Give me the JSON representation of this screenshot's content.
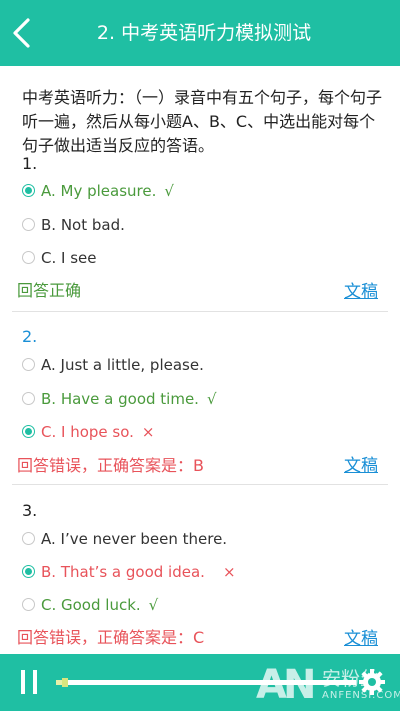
{
  "header": {
    "title": "2. 中考英语听力模拟测试"
  },
  "intro": "中考英语听力：（一）录音中有五个句子，每个句子听一遍，然后从每小题A、B、C、中选出能对每个句子做出适当反应的答语。",
  "questions": [
    {
      "number": "1.",
      "options": [
        {
          "text": "A. My pleasure.",
          "mark": "√",
          "state": "correct-selected"
        },
        {
          "text": "B. Not bad.",
          "mark": "",
          "state": "normal"
        },
        {
          "text": "C. I see",
          "mark": "",
          "state": "normal"
        }
      ],
      "result": "回答正确",
      "doc_link": "文稿"
    },
    {
      "number": "2.",
      "options": [
        {
          "text": "A. Just a little, please.",
          "mark": "",
          "state": "normal"
        },
        {
          "text": "B. Have a good time.",
          "mark": "√",
          "state": "correct"
        },
        {
          "text": "C. I hope so.",
          "mark": "×",
          "state": "wrong-selected"
        }
      ],
      "result": "回答错误，正确答案是：B",
      "doc_link": "文稿"
    },
    {
      "number": "3.",
      "options": [
        {
          "text": "A. I’ve never been there.",
          "mark": "",
          "state": "normal"
        },
        {
          "text": "B. That’s a good idea.",
          "mark": "×",
          "state": "wrong-selected"
        },
        {
          "text": "C. Good luck.",
          "mark": "√",
          "state": "correct"
        }
      ],
      "result": "回答错误，正确答案是：C",
      "doc_link": "文稿"
    }
  ],
  "player": {
    "progress": 0.02
  },
  "watermark": {
    "logo": "AN",
    "name": "安粉丝",
    "domain": "ANFENSI.COM"
  },
  "colors": {
    "accent": "#1fbfa3",
    "correct": "#4a9a3c",
    "wrong": "#e8535a",
    "link": "#1a8fd6"
  }
}
